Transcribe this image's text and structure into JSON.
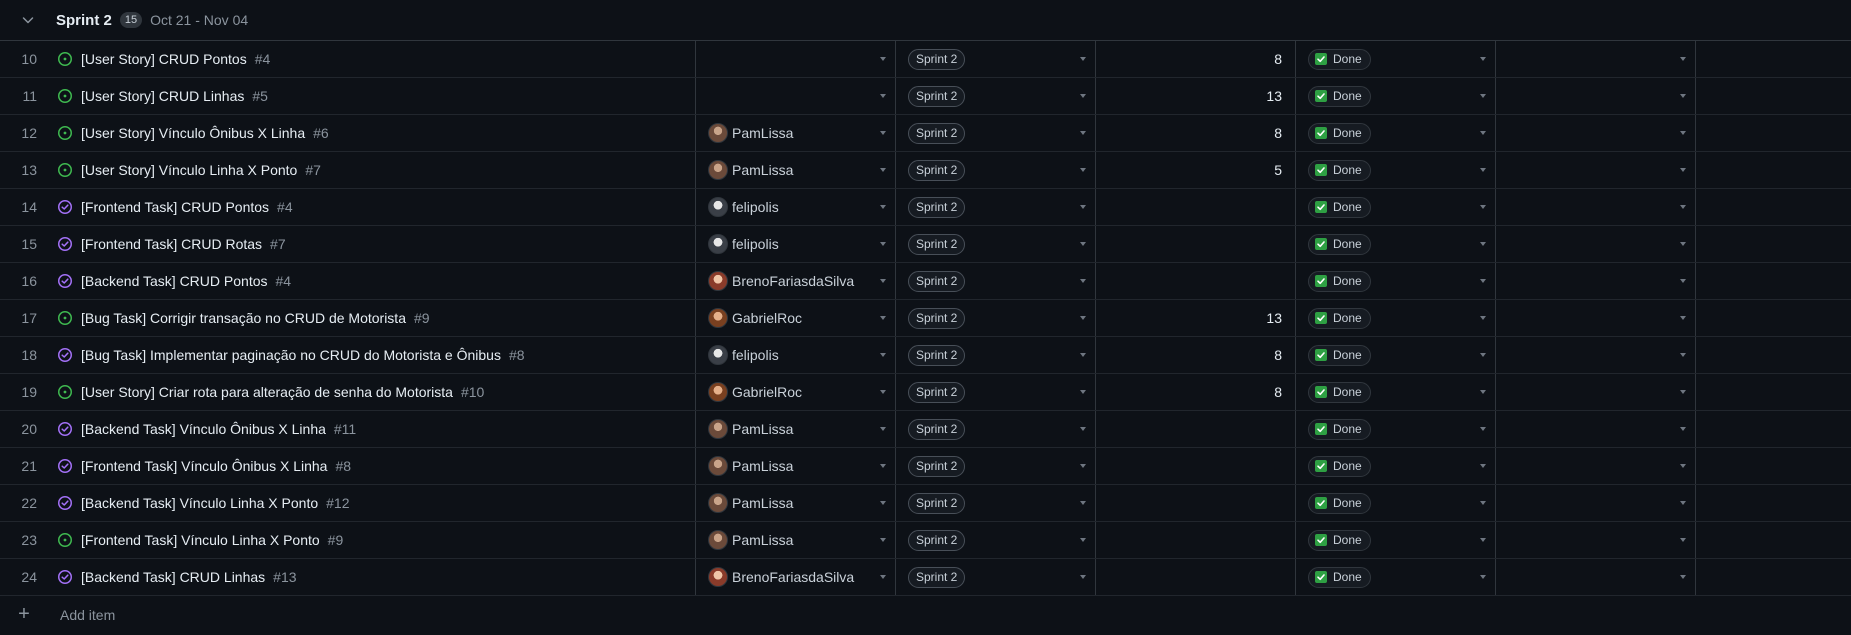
{
  "group": {
    "title": "Sprint 2",
    "count": "15",
    "dates": "Oct 21 - Nov 04"
  },
  "colors": {
    "open_green": "#3fb950",
    "closed_purple": "#a371f7",
    "done_green": "#2ea043"
  },
  "rows": [
    {
      "num": "10",
      "state": "open",
      "title": "[User Story] CRUD Pontos",
      "issue": "#4",
      "assignee": "",
      "avatar": "",
      "sprint": "Sprint 2",
      "points": "8",
      "status": "Done"
    },
    {
      "num": "11",
      "state": "open",
      "title": "[User Story] CRUD Linhas",
      "issue": "#5",
      "assignee": "",
      "avatar": "",
      "sprint": "Sprint 2",
      "points": "13",
      "status": "Done"
    },
    {
      "num": "12",
      "state": "open",
      "title": "[User Story] Vínculo Ônibus X Linha",
      "issue": "#6",
      "assignee": "PamLissa",
      "avatar": "pam",
      "sprint": "Sprint 2",
      "points": "8",
      "status": "Done"
    },
    {
      "num": "13",
      "state": "open",
      "title": "[User Story] Vínculo Linha X Ponto",
      "issue": "#7",
      "assignee": "PamLissa",
      "avatar": "pam",
      "sprint": "Sprint 2",
      "points": "5",
      "status": "Done"
    },
    {
      "num": "14",
      "state": "closed",
      "title": "[Frontend Task] CRUD Pontos",
      "issue": "#4",
      "assignee": "felipolis",
      "avatar": "feli",
      "sprint": "Sprint 2",
      "points": "",
      "status": "Done"
    },
    {
      "num": "15",
      "state": "closed",
      "title": "[Frontend Task] CRUD Rotas",
      "issue": "#7",
      "assignee": "felipolis",
      "avatar": "feli",
      "sprint": "Sprint 2",
      "points": "",
      "status": "Done"
    },
    {
      "num": "16",
      "state": "closed",
      "title": "[Backend Task] CRUD Pontos",
      "issue": "#4",
      "assignee": "BrenoFariasdaSilva",
      "avatar": "breno",
      "sprint": "Sprint 2",
      "points": "",
      "status": "Done"
    },
    {
      "num": "17",
      "state": "open",
      "title": "[Bug Task] Corrigir transação no CRUD de Motorista",
      "issue": "#9",
      "assignee": "GabrielRoc",
      "avatar": "gabriel",
      "sprint": "Sprint 2",
      "points": "13",
      "status": "Done"
    },
    {
      "num": "18",
      "state": "closed",
      "title": "[Bug Task] Implementar paginação no CRUD do Motorista e Ônibus",
      "issue": "#8",
      "assignee": "felipolis",
      "avatar": "feli",
      "sprint": "Sprint 2",
      "points": "8",
      "status": "Done"
    },
    {
      "num": "19",
      "state": "open",
      "title": "[User Story] Criar rota para alteração de senha do Motorista",
      "issue": "#10",
      "assignee": "GabrielRoc",
      "avatar": "gabriel",
      "sprint": "Sprint 2",
      "points": "8",
      "status": "Done"
    },
    {
      "num": "20",
      "state": "closed",
      "title": "[Backend Task] Vínculo Ônibus X Linha",
      "issue": "#11",
      "assignee": "PamLissa",
      "avatar": "pam",
      "sprint": "Sprint 2",
      "points": "",
      "status": "Done"
    },
    {
      "num": "21",
      "state": "closed",
      "title": "[Frontend Task] Vínculo Ônibus X Linha",
      "issue": "#8",
      "assignee": "PamLissa",
      "avatar": "pam",
      "sprint": "Sprint 2",
      "points": "",
      "status": "Done"
    },
    {
      "num": "22",
      "state": "closed",
      "title": "[Backend Task] Vínculo Linha X Ponto",
      "issue": "#12",
      "assignee": "PamLissa",
      "avatar": "pam",
      "sprint": "Sprint 2",
      "points": "",
      "status": "Done"
    },
    {
      "num": "23",
      "state": "open",
      "title": "[Frontend Task] Vínculo Linha X Ponto",
      "issue": "#9",
      "assignee": "PamLissa",
      "avatar": "pam",
      "sprint": "Sprint 2",
      "points": "",
      "status": "Done"
    },
    {
      "num": "24",
      "state": "closed",
      "title": "[Backend Task] CRUD Linhas",
      "issue": "#13",
      "assignee": "BrenoFariasdaSilva",
      "avatar": "breno",
      "sprint": "Sprint 2",
      "points": "",
      "status": "Done"
    }
  ],
  "add_item_label": "Add item"
}
